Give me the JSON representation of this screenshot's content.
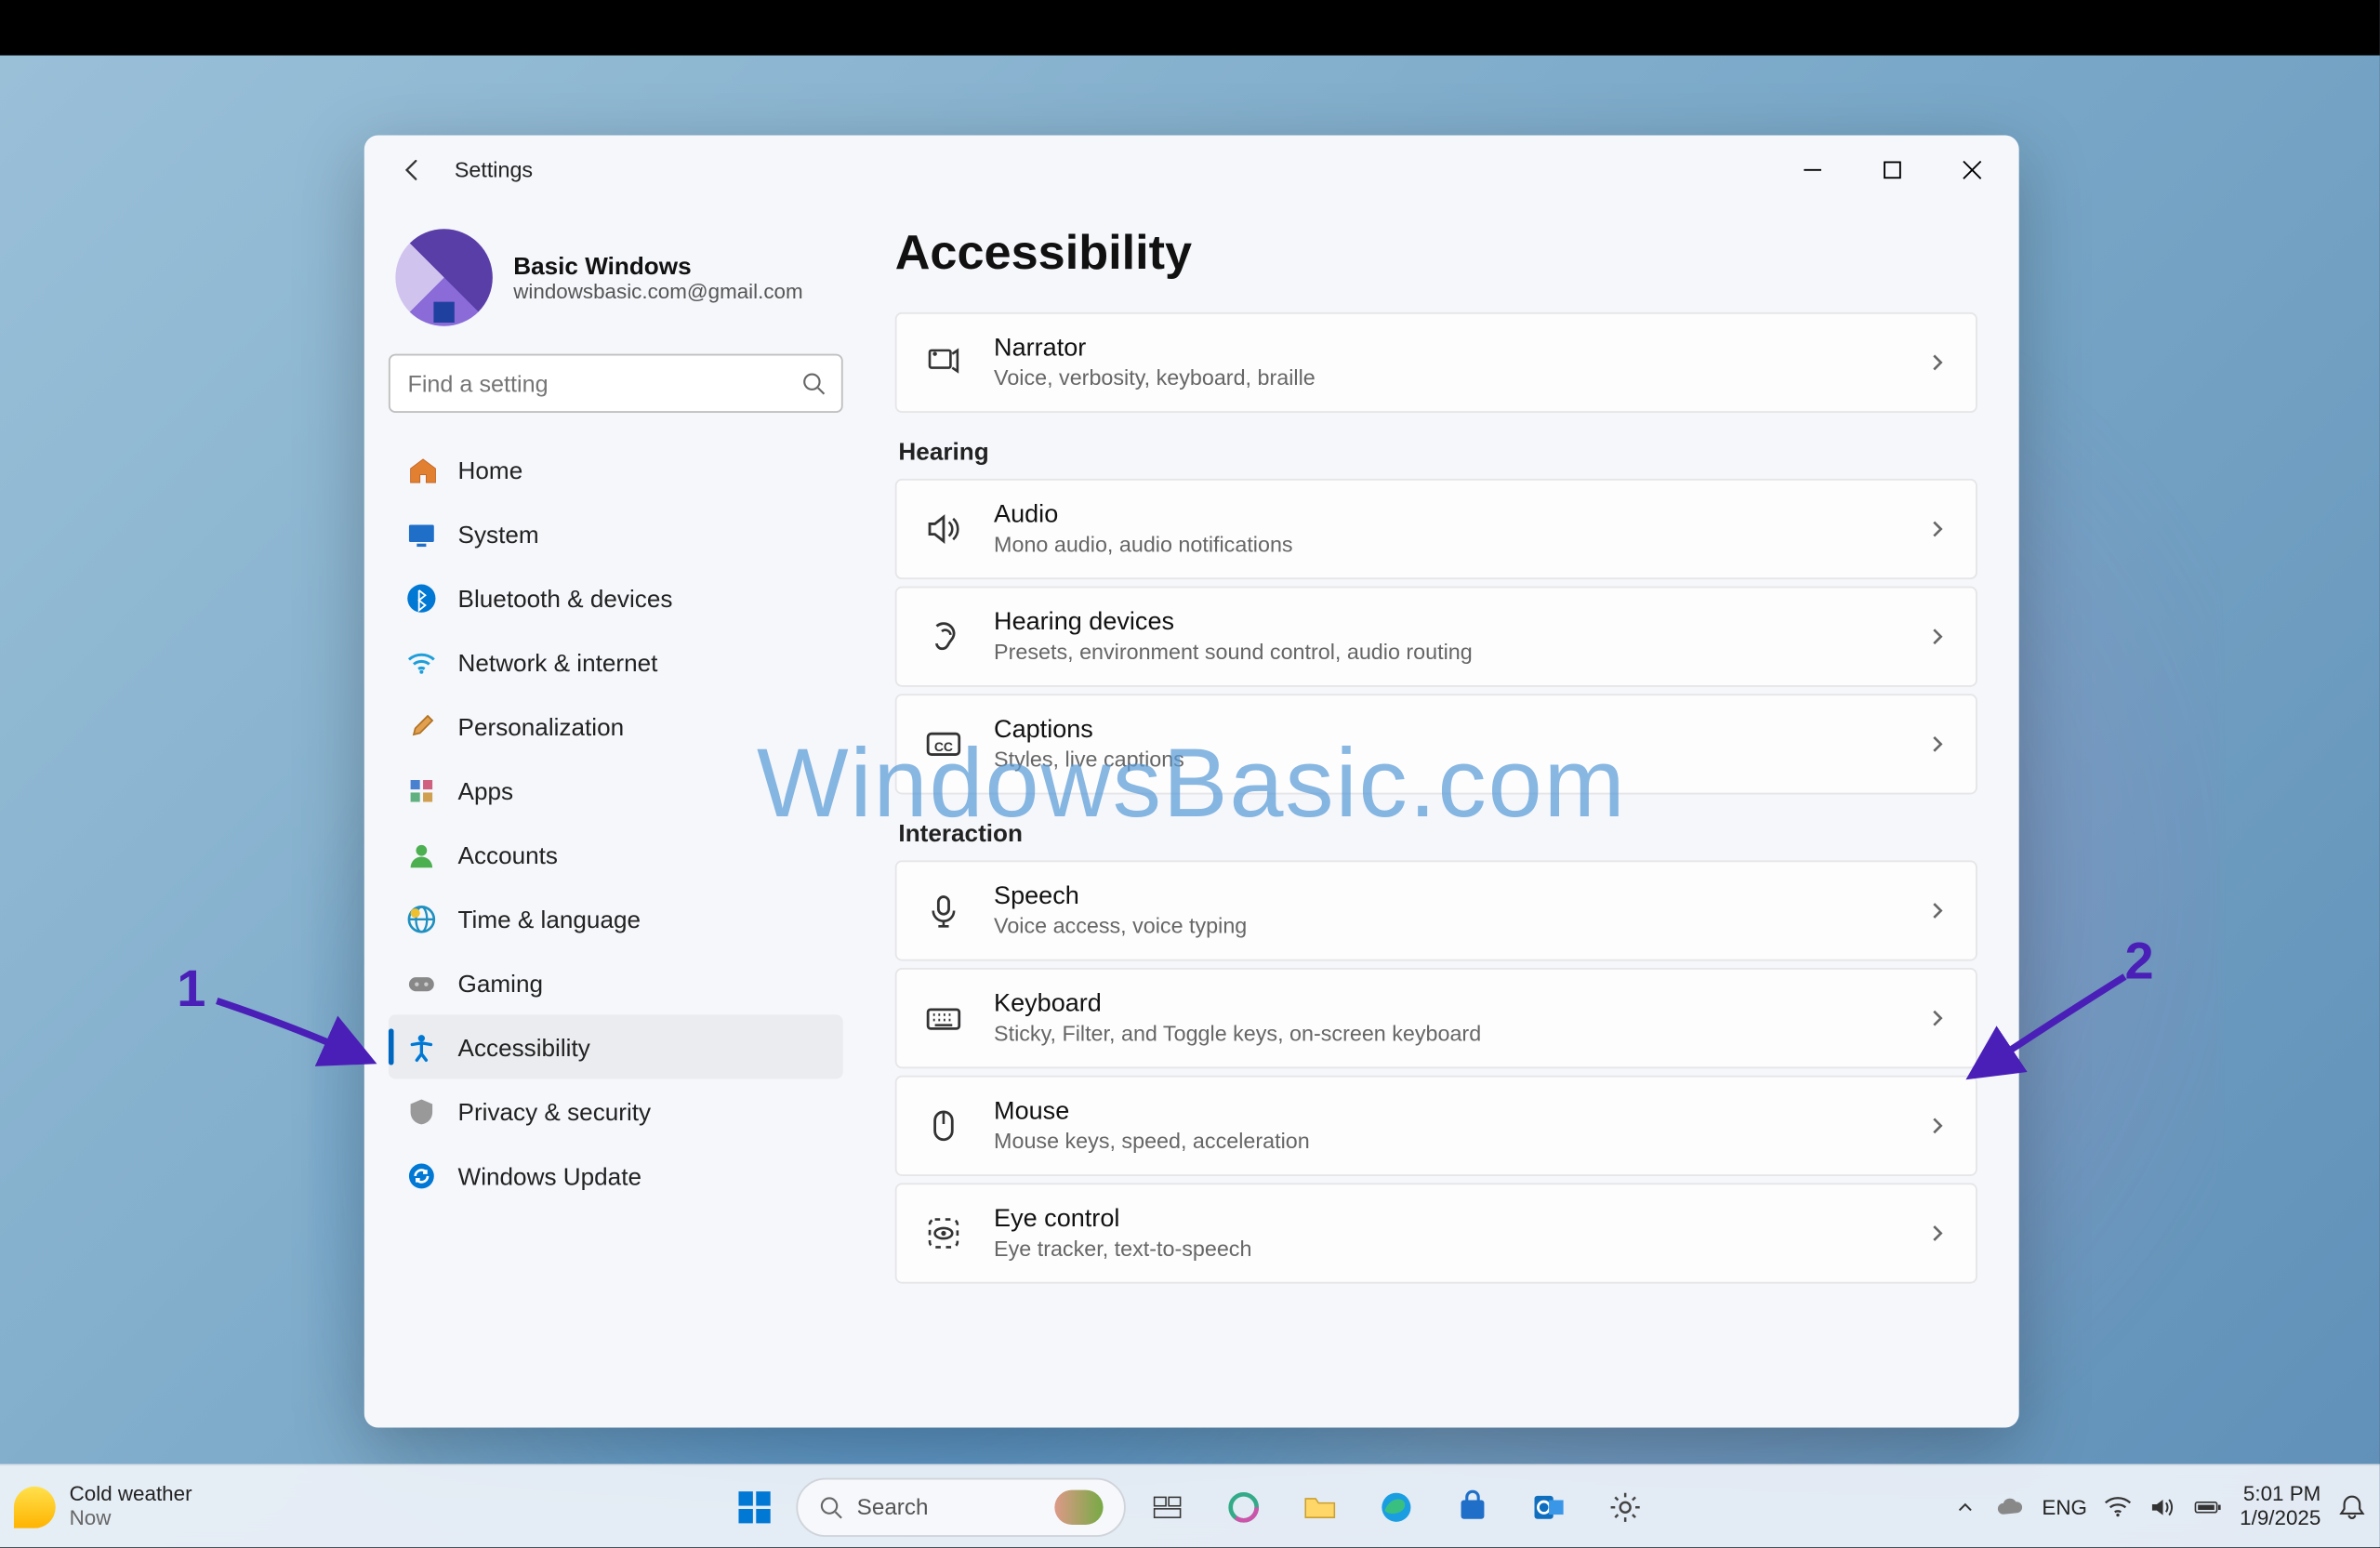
{
  "window": {
    "title": "Settings",
    "page_title": "Accessibility"
  },
  "user": {
    "name": "Basic Windows",
    "email": "windowsbasic.com@gmail.com"
  },
  "search": {
    "placeholder": "Find a setting"
  },
  "nav": [
    {
      "label": "Home",
      "icon": "home"
    },
    {
      "label": "System",
      "icon": "system"
    },
    {
      "label": "Bluetooth & devices",
      "icon": "bluetooth"
    },
    {
      "label": "Network & internet",
      "icon": "wifi"
    },
    {
      "label": "Personalization",
      "icon": "brush"
    },
    {
      "label": "Apps",
      "icon": "apps"
    },
    {
      "label": "Accounts",
      "icon": "person"
    },
    {
      "label": "Time & language",
      "icon": "globe"
    },
    {
      "label": "Gaming",
      "icon": "gamepad"
    },
    {
      "label": "Accessibility",
      "icon": "accessibility",
      "active": true
    },
    {
      "label": "Privacy & security",
      "icon": "shield"
    },
    {
      "label": "Windows Update",
      "icon": "update"
    }
  ],
  "cards_top": [
    {
      "title": "Narrator",
      "sub": "Voice, verbosity, keyboard, braille",
      "icon": "narrator"
    }
  ],
  "sections": [
    {
      "label": "Hearing",
      "items": [
        {
          "title": "Audio",
          "sub": "Mono audio, audio notifications",
          "icon": "audio"
        },
        {
          "title": "Hearing devices",
          "sub": "Presets, environment sound control, audio routing",
          "icon": "hearing"
        },
        {
          "title": "Captions",
          "sub": "Styles, live captions",
          "icon": "captions"
        }
      ]
    },
    {
      "label": "Interaction",
      "items": [
        {
          "title": "Speech",
          "sub": "Voice access, voice typing",
          "icon": "mic"
        },
        {
          "title": "Keyboard",
          "sub": "Sticky, Filter, and Toggle keys, on-screen keyboard",
          "icon": "keyboard"
        },
        {
          "title": "Mouse",
          "sub": "Mouse keys, speed, acceleration",
          "icon": "mouse"
        },
        {
          "title": "Eye control",
          "sub": "Eye tracker, text-to-speech",
          "icon": "eye"
        }
      ]
    }
  ],
  "watermark": "WindowsBasic.com",
  "annotations": {
    "label1": "1",
    "label2": "2"
  },
  "taskbar": {
    "weather_title": "Cold weather",
    "weather_sub": "Now",
    "search_placeholder": "Search",
    "lang": "ENG",
    "time": "5:01 PM",
    "date": "1/9/2025"
  }
}
